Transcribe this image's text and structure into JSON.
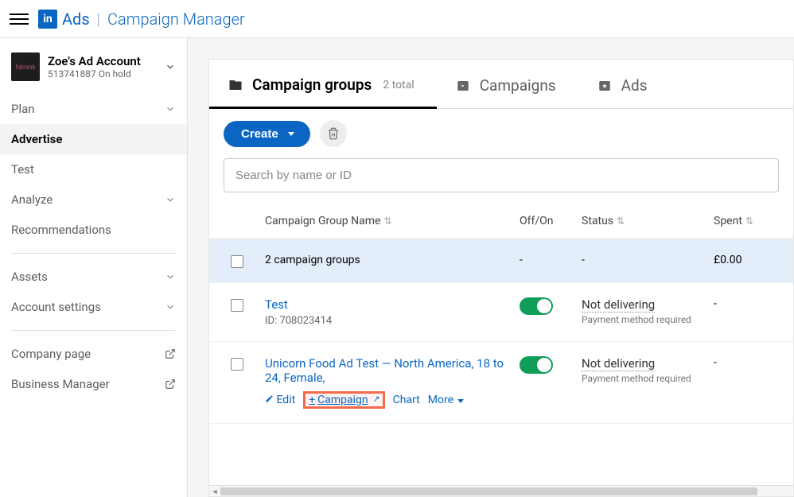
{
  "header": {
    "brand1": "Ads",
    "brand2": "Campaign Manager"
  },
  "account": {
    "name": "Zoe's Ad Account",
    "id": "513741887",
    "status": "On hold"
  },
  "sidebar": {
    "items": [
      {
        "label": "Plan",
        "expandable": true
      },
      {
        "label": "Advertise",
        "active": true
      },
      {
        "label": "Test"
      },
      {
        "label": "Analyze",
        "expandable": true
      },
      {
        "label": "Recommendations"
      }
    ],
    "items2": [
      {
        "label": "Assets",
        "expandable": true
      },
      {
        "label": "Account settings",
        "expandable": true
      }
    ],
    "items3": [
      {
        "label": "Company page",
        "external": true
      },
      {
        "label": "Business Manager",
        "external": true
      }
    ]
  },
  "tabs": {
    "groups": "Campaign groups",
    "groups_count": "2 total",
    "campaigns": "Campaigns",
    "ads": "Ads"
  },
  "toolbar": {
    "create": "Create"
  },
  "search": {
    "placeholder": "Search by name or ID"
  },
  "columns": {
    "name": "Campaign Group Name",
    "off": "Off/On",
    "status": "Status",
    "spent": "Spent"
  },
  "summary": {
    "text": "2 campaign groups",
    "spent": "£0.00"
  },
  "rows": [
    {
      "name": "Test",
      "id": "ID: 708023414",
      "status": "Not delivering",
      "status_sub": "Payment method required",
      "spent": "-"
    },
    {
      "name": "Unicorn Food Ad Test — North America, 18 to 24, Female,",
      "status": "Not delivering",
      "status_sub": "Payment method required",
      "spent": "-",
      "actions": {
        "edit": "Edit",
        "campaign": "Campaign",
        "chart": "Chart",
        "more": "More"
      }
    }
  ]
}
